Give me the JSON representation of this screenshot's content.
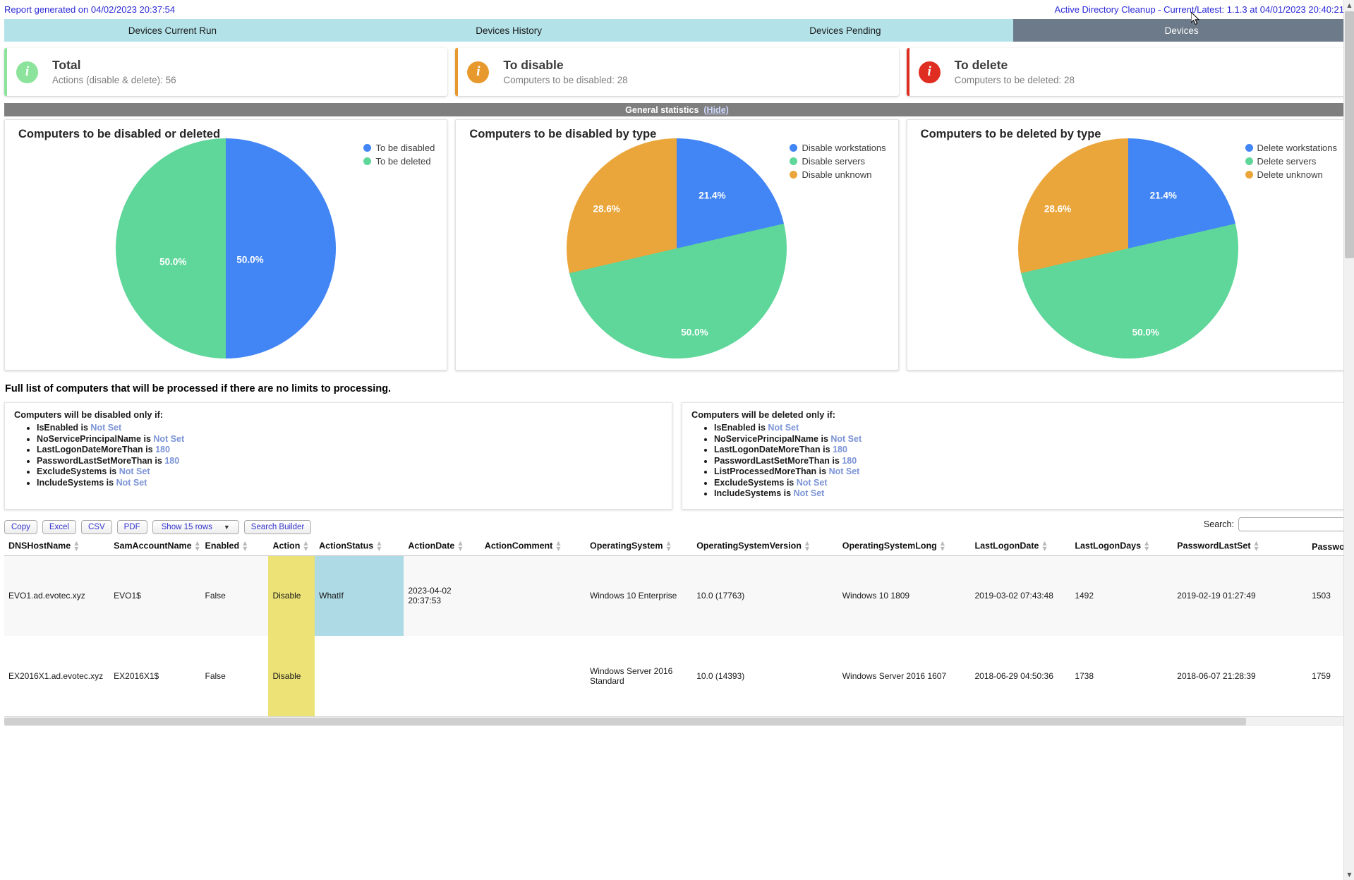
{
  "header": {
    "report_generated": "Report generated on 04/02/2023 20:37:54",
    "app_version": "Active Directory Cleanup - Current/Latest: 1.1.3 at 04/01/2023 20:40:21"
  },
  "tabs": [
    {
      "label": "Devices Current Run",
      "active": false
    },
    {
      "label": "Devices History",
      "active": false
    },
    {
      "label": "Devices Pending",
      "active": false
    },
    {
      "label": "Devices",
      "active": true
    }
  ],
  "cards": [
    {
      "title": "Total",
      "subtitle": "Actions (disable & delete): 56",
      "accent": "#8ce39b",
      "icon": "info-icon"
    },
    {
      "title": "To disable",
      "subtitle": "Computers to be disabled: 28",
      "accent": "#e8992e",
      "icon": "info-icon"
    },
    {
      "title": "To delete",
      "subtitle": "Computers to be deleted: 28",
      "accent": "#e02d21",
      "icon": "info-icon"
    }
  ],
  "stat_band": {
    "label": "General statistics",
    "hide_link": "(Hide)"
  },
  "chart_data": [
    {
      "type": "pie",
      "title": "Computers to be disabled or deleted",
      "labels": [
        "To be disabled",
        "To be deleted"
      ],
      "values": [
        50.0,
        50.0
      ],
      "value_labels": [
        "50.0%",
        "50.0%"
      ],
      "colors": [
        "#4285f4",
        "#5fd69a"
      ],
      "legend_position": "top-right"
    },
    {
      "type": "pie",
      "title": "Computers to be disabled by type",
      "labels": [
        "Disable workstations",
        "Disable servers",
        "Disable unknown"
      ],
      "values": [
        21.4,
        50.0,
        28.6
      ],
      "value_labels": [
        "21.4%",
        "50.0%",
        "28.6%"
      ],
      "colors": [
        "#4285f4",
        "#5fd69a",
        "#eaa63b"
      ],
      "legend_position": "top-right"
    },
    {
      "type": "pie",
      "title": "Computers to be deleted by type",
      "labels": [
        "Delete workstations",
        "Delete servers",
        "Delete unknown"
      ],
      "values": [
        21.4,
        50.0,
        28.6
      ],
      "value_labels": [
        "21.4%",
        "50.0%",
        "28.6%"
      ],
      "colors": [
        "#4285f4",
        "#5fd69a",
        "#eaa63b"
      ],
      "legend_position": "top-right"
    }
  ],
  "full_list_heading": "Full list of computers that will be processed if there are no limits to processing.",
  "criteria": [
    {
      "heading": "Computers will be disabled only if:",
      "items": [
        {
          "name": "IsEnabled",
          "value": "Not Set"
        },
        {
          "name": "NoServicePrincipalName",
          "value": "Not Set"
        },
        {
          "name": "LastLogonDateMoreThan",
          "value": "180"
        },
        {
          "name": "PasswordLastSetMoreThan",
          "value": "180"
        },
        {
          "name": "ExcludeSystems",
          "value": "Not Set"
        },
        {
          "name": "IncludeSystems",
          "value": "Not Set"
        }
      ]
    },
    {
      "heading": "Computers will be deleted only if:",
      "items": [
        {
          "name": "IsEnabled",
          "value": "Not Set"
        },
        {
          "name": "NoServicePrincipalName",
          "value": "Not Set"
        },
        {
          "name": "LastLogonDateMoreThan",
          "value": "180"
        },
        {
          "name": "PasswordLastSetMoreThan",
          "value": "180"
        },
        {
          "name": "ListProcessedMoreThan",
          "value": "Not Set"
        },
        {
          "name": "ExcludeSystems",
          "value": "Not Set"
        },
        {
          "name": "IncludeSystems",
          "value": "Not Set"
        }
      ]
    }
  ],
  "toolbar": {
    "copy": "Copy",
    "excel": "Excel",
    "csv": "CSV",
    "pdf": "PDF",
    "show_rows": "Show 15 rows",
    "search_builder": "Search Builder",
    "search_label": "Search:",
    "search_value": "",
    "search_placeholder": ""
  },
  "table": {
    "columns": [
      "DNSHostName",
      "SamAccountName",
      "Enabled",
      "Action",
      "ActionStatus",
      "ActionDate",
      "ActionComment",
      "OperatingSystem",
      "OperatingSystemVersion",
      "OperatingSystemLong",
      "LastLogonDate",
      "LastLogonDays",
      "PasswordLastSet",
      "PasswordLa"
    ],
    "rows": [
      {
        "DNSHostName": "EVO1.ad.evotec.xyz",
        "SamAccountName": "EVO1$",
        "Enabled": "False",
        "Action": "Disable",
        "ActionStatus": "WhatIf",
        "ActionDate": "2023-04-02 20:37:53",
        "ActionComment": "",
        "OperatingSystem": "Windows 10 Enterprise",
        "OperatingSystemVersion": "10.0 (17763)",
        "OperatingSystemLong": "Windows 10 1809",
        "LastLogonDate": "2019-03-02 07:43:48",
        "LastLogonDays": "1492",
        "PasswordLastSet": "2019-02-19 01:27:49",
        "PasswordLa": "1503"
      },
      {
        "DNSHostName": "EX2016X1.ad.evotec.xyz",
        "SamAccountName": "EX2016X1$",
        "Enabled": "False",
        "Action": "Disable",
        "ActionStatus": "",
        "ActionDate": "",
        "ActionComment": "",
        "OperatingSystem": "Windows Server 2016 Standard",
        "OperatingSystemVersion": "10.0 (14393)",
        "OperatingSystemLong": "Windows Server 2016 1607",
        "LastLogonDate": "2018-06-29 04:50:36",
        "LastLogonDays": "1738",
        "PasswordLastSet": "2018-06-07 21:28:39",
        "PasswordLa": "1759"
      }
    ]
  }
}
